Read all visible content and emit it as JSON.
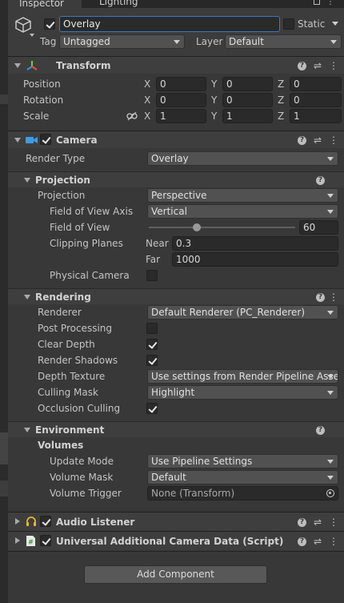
{
  "tabs": {
    "inspector": "Inspector",
    "lighting": "Lighting"
  },
  "header": {
    "object_name": "Overlay",
    "static_label": "Static",
    "tag_label": "Tag",
    "tag_value": "Untagged",
    "layer_label": "Layer",
    "layer_value": "Default"
  },
  "transform": {
    "title": "Transform",
    "position_label": "Position",
    "rotation_label": "Rotation",
    "scale_label": "Scale",
    "axis_x": "X",
    "axis_y": "Y",
    "axis_z": "Z",
    "position": [
      "0",
      "0",
      "0"
    ],
    "rotation": [
      "0",
      "0",
      "0"
    ],
    "scale": [
      "1",
      "1",
      "1"
    ]
  },
  "camera": {
    "title": "Camera",
    "render_type_label": "Render Type",
    "render_type_value": "Overlay",
    "projection_section": "Projection",
    "projection_label": "Projection",
    "projection_value": "Perspective",
    "fov_axis_label": "Field of View Axis",
    "fov_axis_value": "Vertical",
    "fov_label": "Field of View",
    "fov_value": "60",
    "fov_slider_fraction": 0.33,
    "clipping_label": "Clipping Planes",
    "near_label": "Near",
    "near_value": "0.3",
    "far_label": "Far",
    "far_value": "1000",
    "physical_label": "Physical Camera",
    "rendering_section": "Rendering",
    "renderer_label": "Renderer",
    "renderer_value": "Default Renderer (PC_Renderer)",
    "post_label": "Post Processing",
    "clear_depth_label": "Clear Depth",
    "shadows_label": "Render Shadows",
    "depth_tex_label": "Depth Texture",
    "depth_tex_value": "Use settings from Render Pipeline Asse",
    "culling_label": "Culling Mask",
    "culling_value": "Highlight",
    "occlusion_label": "Occlusion Culling",
    "environment_section": "Environment",
    "volumes_label": "Volumes",
    "update_mode_label": "Update Mode",
    "update_mode_value": "Use Pipeline Settings",
    "volume_mask_label": "Volume Mask",
    "volume_mask_value": "Default",
    "volume_trigger_label": "Volume Trigger",
    "volume_trigger_value": "None (Transform)"
  },
  "audio_listener": {
    "title": "Audio Listener"
  },
  "additional_data": {
    "title": "Universal Additional Camera Data (Script)"
  },
  "add_component_label": "Add Component",
  "colors": {
    "accent_blue": "#3a79bb",
    "panel_bg": "#383838",
    "field_bg": "#2a2a2a"
  }
}
